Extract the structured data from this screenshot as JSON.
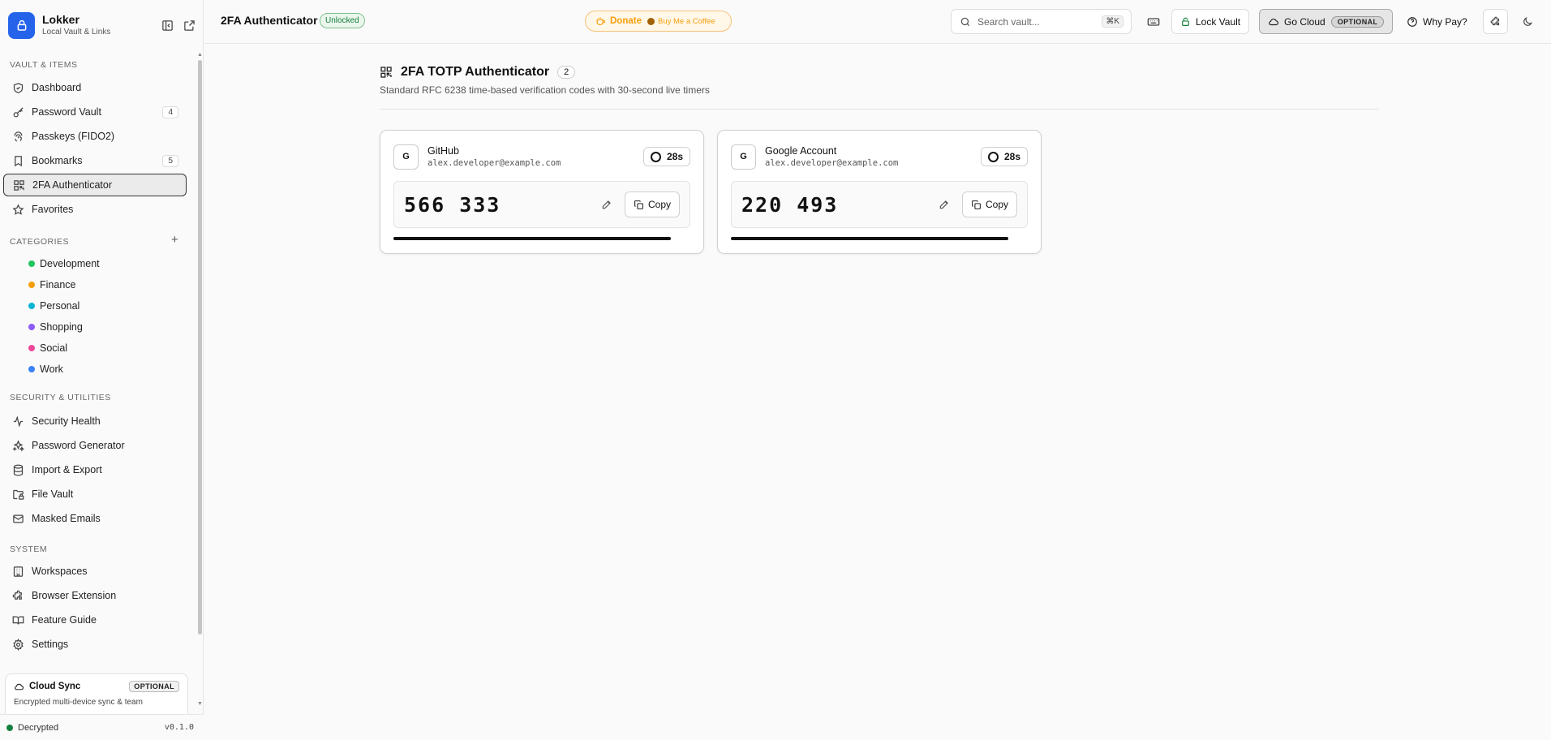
{
  "app": {
    "name": "Lokker",
    "subtitle": "Local Vault & Links"
  },
  "sidebar": {
    "sections": {
      "vault": "VAULT & ITEMS",
      "categories": "CATEGORIES",
      "security": "SECURITY & UTILITIES",
      "system": "SYSTEM"
    },
    "vault_items": [
      {
        "label": "Dashboard",
        "icon": "shield-icon"
      },
      {
        "label": "Password Vault",
        "icon": "key-icon",
        "count": "4"
      },
      {
        "label": "Passkeys (FIDO2)",
        "icon": "fingerprint-icon"
      },
      {
        "label": "Bookmarks",
        "icon": "bookmark-icon",
        "count": "5"
      },
      {
        "label": "2FA Authenticator",
        "icon": "qr-code-icon",
        "active": true
      },
      {
        "label": "Favorites",
        "icon": "star-icon"
      }
    ],
    "categories": [
      {
        "label": "Development",
        "color": "#22c55e"
      },
      {
        "label": "Finance",
        "color": "#f59e0b"
      },
      {
        "label": "Personal",
        "color": "#06b6d4"
      },
      {
        "label": "Shopping",
        "color": "#8b5cf6"
      },
      {
        "label": "Social",
        "color": "#ec4899"
      },
      {
        "label": "Work",
        "color": "#3b82f6"
      }
    ],
    "security_items": [
      {
        "label": "Security Health",
        "icon": "activity-icon"
      },
      {
        "label": "Password Generator",
        "icon": "sparkles-icon"
      },
      {
        "label": "Import & Export",
        "icon": "database-icon"
      },
      {
        "label": "File Vault",
        "icon": "folder-lock-icon"
      },
      {
        "label": "Masked Emails",
        "icon": "mail-icon"
      }
    ],
    "system_items": [
      {
        "label": "Workspaces",
        "icon": "building-icon"
      },
      {
        "label": "Browser Extension",
        "icon": "puzzle-icon"
      },
      {
        "label": "Feature Guide",
        "icon": "book-icon"
      },
      {
        "label": "Settings",
        "icon": "gear-icon"
      }
    ],
    "cloud_card": {
      "title": "Cloud Sync",
      "badge": "OPTIONAL",
      "description": "Encrypted multi-device sync & team"
    },
    "footer": {
      "status": "Decrypted",
      "version": "v0.1.0"
    }
  },
  "header": {
    "title": "2FA Authenticator",
    "status_badge": "Unlocked",
    "donate": {
      "label": "Donate",
      "coffee": "Buy Me a Coffee"
    },
    "search": {
      "placeholder": "Search vault...",
      "shortcut": "⌘K"
    },
    "lock_label": "Lock Vault",
    "cloud_label": "Go Cloud",
    "cloud_badge": "OPTIONAL",
    "why_pay_label": "Why Pay?"
  },
  "main": {
    "title": "2FA TOTP Authenticator",
    "count": "2",
    "subtitle": "Standard RFC 6238 time-based verification codes with 30-second live timers",
    "accounts": [
      {
        "initial": "G",
        "name": "GitHub",
        "email": "alex.developer@example.com",
        "timer": "28s",
        "code": "566 333",
        "copy_label": "Copy",
        "remaining_fraction": 0.9333
      },
      {
        "initial": "G",
        "name": "Google Account",
        "email": "alex.developer@example.com",
        "timer": "28s",
        "code": "220 493",
        "copy_label": "Copy",
        "remaining_fraction": 0.9333
      }
    ]
  }
}
